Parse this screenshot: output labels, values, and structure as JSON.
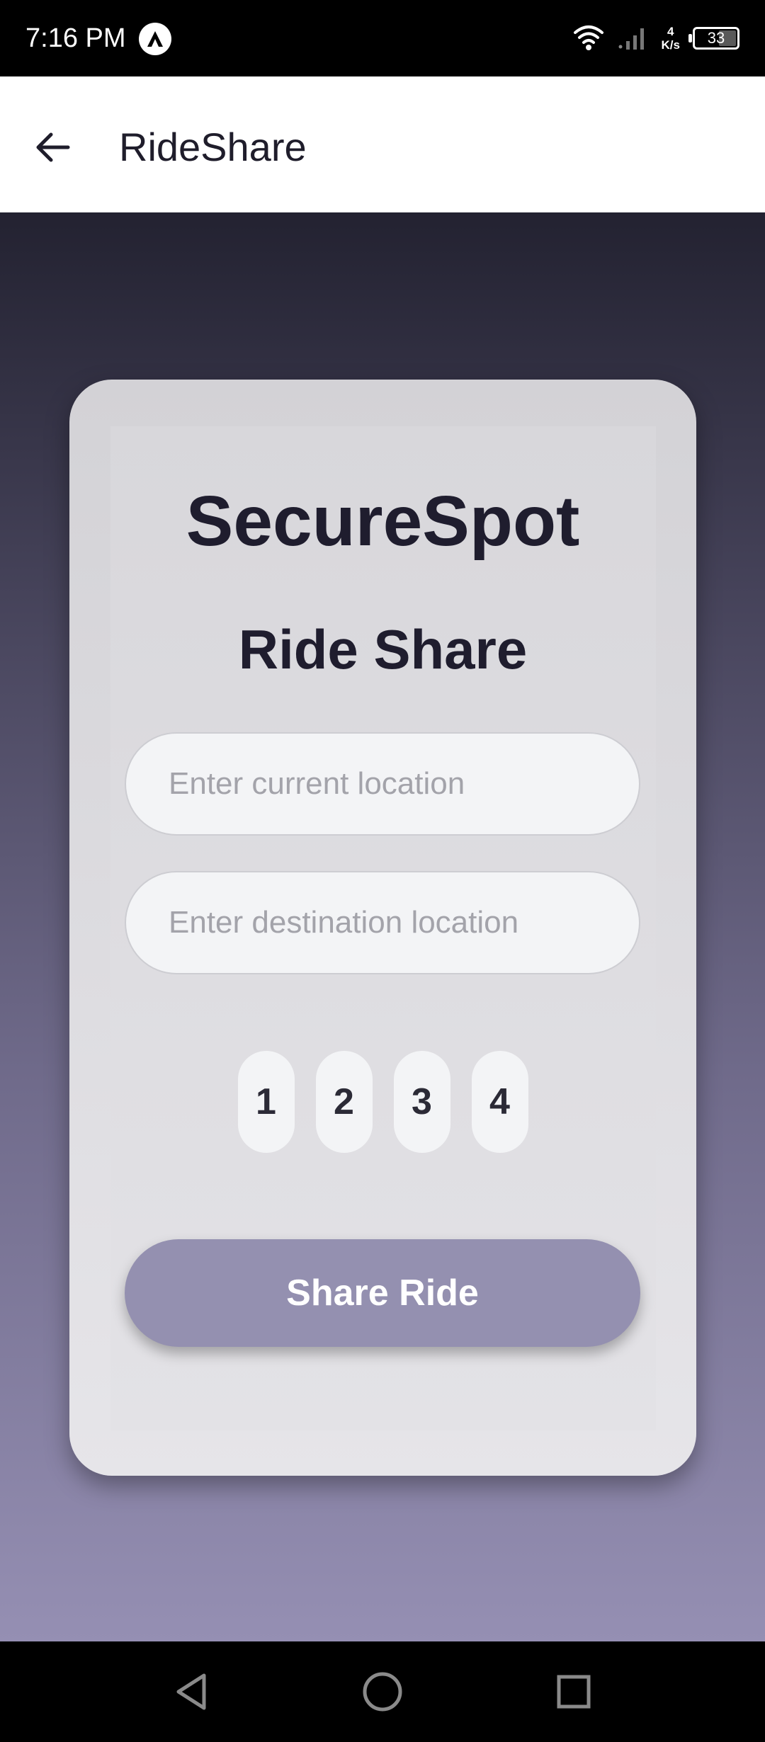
{
  "status_bar": {
    "time": "7:16 PM",
    "net_speed_value": "4",
    "net_speed_unit": "K/s",
    "battery": "33"
  },
  "app_bar": {
    "title": "RideShare"
  },
  "card": {
    "brand": "SecureSpot",
    "heading": "Ride Share",
    "current_location_placeholder": "Enter current location",
    "current_location_value": "",
    "destination_placeholder": "Enter destination location",
    "destination_value": "",
    "seats": [
      "1",
      "2",
      "3",
      "4"
    ],
    "share_button_label": "Share Ride"
  },
  "colors": {
    "accent": "#9490b0",
    "title_text": "#1f1d2e",
    "gradient_top": "#232231",
    "gradient_bottom": "#958fb3"
  },
  "icons": {
    "back": "arrow-left-icon",
    "nav_back": "triangle-back-icon",
    "nav_home": "circle-home-icon",
    "nav_recents": "square-recents-icon"
  }
}
